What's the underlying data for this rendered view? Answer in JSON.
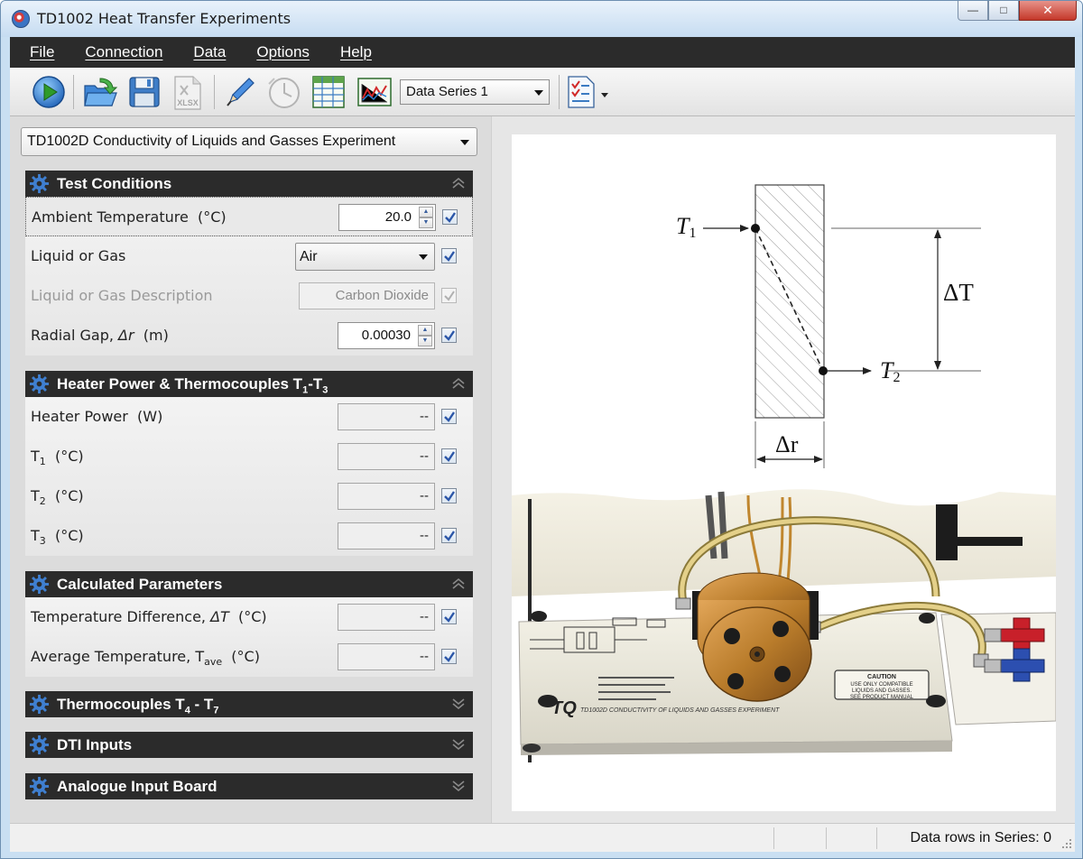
{
  "window": {
    "title": "TD1002 Heat Transfer Experiments",
    "min_glyph": "—",
    "max_glyph": "□",
    "close_glyph": "✕"
  },
  "menu": [
    "File",
    "Connection",
    "Data",
    "Options",
    "Help"
  ],
  "toolbar": {
    "buttons": [
      "play-icon",
      "open-folder-icon",
      "save-icon",
      "xlsx-export-icon",
      "pencil-icon",
      "clock-icon",
      "table-icon",
      "chart-icon",
      "checklist-icon"
    ],
    "xlsx_label": "XLSX",
    "series_selected": "Data Series 1"
  },
  "experiment_selected": "TD1002D Conductivity of Liquids and Gasses Experiment",
  "sections": {
    "test_conditions": {
      "title": "Test Conditions",
      "ambient_label": "Ambient Temperature",
      "ambient_unit": "(°C)",
      "ambient_value": "20.0",
      "fluid_label": "Liquid or Gas",
      "fluid_value": "Air",
      "desc_label": "Liquid or Gas Description",
      "desc_value": "Carbon Dioxide",
      "gap_label": "Radial Gap,",
      "gap_symbol": "Δr",
      "gap_unit": "(m)",
      "gap_value": "0.00030"
    },
    "heater": {
      "title_main": "Heater Power & Thermocouples T",
      "title_sub1": "1",
      "title_dash": "-T",
      "title_sub3": "3",
      "power_label": "Heater Power",
      "power_unit": "(W)",
      "power_value": "--",
      "t_prefix": "T",
      "t1_sub": "1",
      "t2_sub": "2",
      "t3_sub": "3",
      "t_unit": "(°C)",
      "t1_value": "--",
      "t2_value": "--",
      "t3_value": "--"
    },
    "calculated": {
      "title": "Calculated Parameters",
      "dt_label": "Temperature Difference,",
      "dt_symbol": "ΔT",
      "dt_unit": "(°C)",
      "dt_value": "--",
      "avg_label": "Average Temperature, T",
      "avg_sub": "ave",
      "avg_unit": "(°C)",
      "avg_value": "--"
    },
    "thermocouples_4_7": {
      "title_main": "Thermocouples T",
      "sub4": "4",
      "dash": " - T",
      "sub7": "7"
    },
    "dti": {
      "title": "DTI Inputs"
    },
    "analogue": {
      "title": "Analogue Input Board"
    }
  },
  "diagram": {
    "t1_label": "T",
    "t1_sub": "1",
    "t2_label": "T",
    "t2_sub": "2",
    "delta_t_label": "ΔT",
    "delta_r_label": "Δr"
  },
  "apparatus": {
    "plate_label": "TD1002D CONDUCTIVITY OF LIQUIDS AND GASSES EXPERIMENT",
    "logo_text": "TQ",
    "caution_title": "CAUTION",
    "caution_line1": "USE ONLY COMPATIBLE",
    "caution_line2": "LIQUIDS AND GASSES.",
    "caution_line3": "SEE PRODUCT MANUAL"
  },
  "status": {
    "text": "Data rows in Series: 0"
  },
  "colors": {
    "menubar": "#2b2b2b",
    "section_header": "#2b2b2b",
    "gear": "#3f7fd0",
    "check": "#2b56a8",
    "brass": "#b97c2b"
  }
}
